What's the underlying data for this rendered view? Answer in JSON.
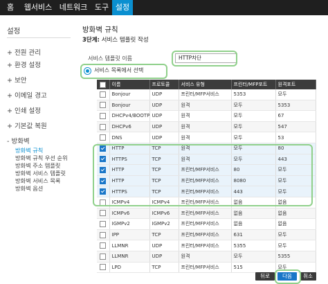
{
  "nav": {
    "tabs": [
      "홈",
      "웹서비스",
      "네트워크",
      "도구",
      "설정"
    ],
    "active": "설정"
  },
  "sidebar": {
    "title": "설정",
    "items": [
      "+ 전원 관리",
      "+ 환경 설정",
      "+ 보안",
      "+ 이메일 경고",
      "+ 인쇄 설정",
      "+ 기본값 복원",
      "- 방화벽"
    ],
    "subitems": [
      "방화벽 규칙",
      "방화벽 규칙 우선 순위",
      "방화벽 주소 템플릿",
      "방화벽 서비스 템플릿",
      "방화벽 서비스 목록",
      "방화벽 옵션"
    ],
    "active_subitem": "방화벽 규칙"
  },
  "main": {
    "title": "방화벽 규칙",
    "step_prefix": "3단계:",
    "step_text": "서비스 템플릿 작성",
    "template_name_label": "서비스 템플릿 이름",
    "template_name_value": "HTTP차단",
    "radio_label": "서비스 목록에서 선택"
  },
  "table": {
    "headers": [
      "이름",
      "프로토콜",
      "서비스 유형",
      "프린터/MFP포트",
      "원격포트"
    ],
    "rows": [
      {
        "checked": false,
        "name": "Bonjour",
        "protocol": "UDP",
        "type": "프린터/MFP서비스",
        "printer_port": "5353",
        "remote_port": "모두"
      },
      {
        "checked": false,
        "name": "Bonjour",
        "protocol": "UDP",
        "type": "원격",
        "printer_port": "모두",
        "remote_port": "5353"
      },
      {
        "checked": false,
        "name": "DHCPv4/BOOTP",
        "protocol": "UDP",
        "type": "원격",
        "printer_port": "모두",
        "remote_port": "67"
      },
      {
        "checked": false,
        "name": "DHCPv6",
        "protocol": "UDP",
        "type": "원격",
        "printer_port": "모두",
        "remote_port": "547"
      },
      {
        "checked": false,
        "name": "DNS",
        "protocol": "UDP",
        "type": "원격",
        "printer_port": "모두",
        "remote_port": "53"
      },
      {
        "checked": true,
        "name": "HTTP",
        "protocol": "TCP",
        "type": "원격",
        "printer_port": "모두",
        "remote_port": "80"
      },
      {
        "checked": true,
        "name": "HTTPS",
        "protocol": "TCP",
        "type": "원격",
        "printer_port": "모두",
        "remote_port": "443"
      },
      {
        "checked": true,
        "name": "HTTP",
        "protocol": "TCP",
        "type": "프린터/MFP서비스",
        "printer_port": "80",
        "remote_port": "모두"
      },
      {
        "checked": true,
        "name": "HTTP",
        "protocol": "TCP",
        "type": "프린터/MFP서비스",
        "printer_port": "8080",
        "remote_port": "모두"
      },
      {
        "checked": true,
        "name": "HTTPS",
        "protocol": "TCP",
        "type": "프린터/MFP서비스",
        "printer_port": "443",
        "remote_port": "모두"
      },
      {
        "checked": false,
        "name": "ICMPv4",
        "protocol": "ICMPv4",
        "type": "프린터/MFP서비스",
        "printer_port": "없음",
        "remote_port": "없음"
      },
      {
        "checked": false,
        "name": "ICMPv6",
        "protocol": "ICMPv6",
        "type": "프린터/MFP서비스",
        "printer_port": "없음",
        "remote_port": "없음"
      },
      {
        "checked": false,
        "name": "IGMPv2",
        "protocol": "IGMPv2",
        "type": "프린터/MFP서비스",
        "printer_port": "없음",
        "remote_port": "없음"
      },
      {
        "checked": false,
        "name": "IPP",
        "protocol": "TCP",
        "type": "프린터/MFP서비스",
        "printer_port": "631",
        "remote_port": "모두"
      },
      {
        "checked": false,
        "name": "LLMNR",
        "protocol": "UDP",
        "type": "프린터/MFP서비스",
        "printer_port": "5355",
        "remote_port": "모두"
      },
      {
        "checked": false,
        "name": "LLMNR",
        "protocol": "UDP",
        "type": "원격",
        "printer_port": "모두",
        "remote_port": "5355"
      },
      {
        "checked": false,
        "name": "LPD",
        "protocol": "TCP",
        "type": "프린터/MFP서비스",
        "printer_port": "515",
        "remote_port": "모두"
      }
    ]
  },
  "buttons": {
    "prev": "뒤로",
    "next": "다음",
    "cancel": "취소"
  },
  "colors": {
    "accent": "#0a8fd0",
    "highlight": "#8fd08a",
    "header_bg": "#3c3c3c",
    "nav_bg": "#1f1f1f"
  }
}
